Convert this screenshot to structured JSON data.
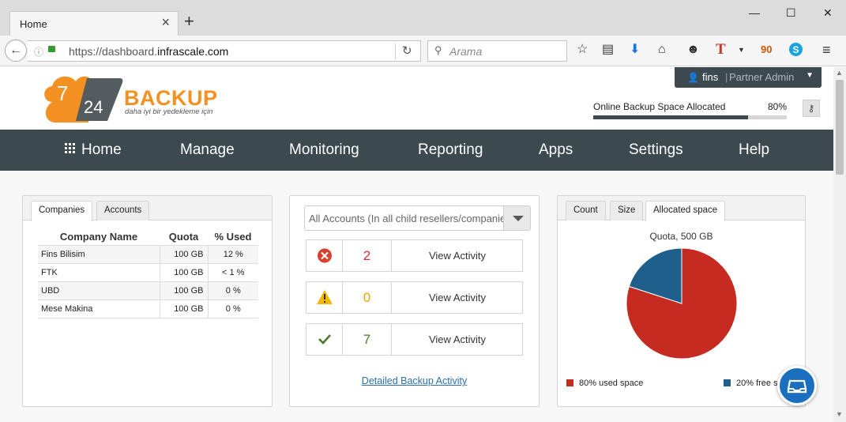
{
  "browser": {
    "tab_title": "Home",
    "url_prefix": "https://dashboard.",
    "url_domain": "infrascale.com",
    "search_placeholder": "Arama",
    "window_buttons": {
      "minimize": "—",
      "maximize": "☐",
      "close": "✕"
    }
  },
  "toolbar_icons": [
    "star-icon",
    "reader-icon",
    "download-icon",
    "home-icon",
    "emoji-icon",
    "t-extension-icon",
    "dropdown-icon",
    "90-extension-icon",
    "skype-icon",
    "menu-icon"
  ],
  "header": {
    "logo_number_7": "7",
    "logo_number_24": "24",
    "logo_word": "BACKUP",
    "logo_tagline": "daha iyi bir yedekleme için",
    "user_name": "fins",
    "user_separator": "|",
    "user_role": "Partner Admin",
    "allocated_label": "Online Backup Space Allocated",
    "allocated_pct": "80%",
    "allocated_fraction": 0.8
  },
  "nav": {
    "items": [
      {
        "label": "Home"
      },
      {
        "label": "Manage"
      },
      {
        "label": "Monitoring"
      },
      {
        "label": "Reporting"
      },
      {
        "label": "Apps"
      },
      {
        "label": "Settings"
      },
      {
        "label": "Help"
      }
    ]
  },
  "companies_panel": {
    "tabs": [
      "Companies",
      "Accounts"
    ],
    "columns": [
      "Company Name",
      "Quota",
      "% Used"
    ],
    "rows": [
      [
        "Fins Bilisim",
        "100 GB",
        "12 %"
      ],
      [
        "FTK",
        "100 GB",
        "< 1 %"
      ],
      [
        "UBD",
        "100 GB",
        "0 %"
      ],
      [
        "Mese Makina",
        "100 GB",
        "0 %"
      ]
    ]
  },
  "activity_panel": {
    "select_value": "All Accounts (In all child resellers/companies)",
    "rows": [
      {
        "icon": "error-icon",
        "count": "2",
        "count_color": "#cc3333",
        "action": "View Activity"
      },
      {
        "icon": "warning-icon",
        "count": "0",
        "count_color": "#e0a800",
        "action": "View Activity"
      },
      {
        "icon": "check-icon",
        "count": "7",
        "count_color": "#4a7a2a",
        "action": "View Activity"
      }
    ],
    "detail_link": "Detailed Backup Activity"
  },
  "space_panel": {
    "tabs": [
      "Count",
      "Size",
      "Allocated space"
    ],
    "pie_title": "Quota, 500 GB",
    "slices": [
      {
        "label": "80% used space",
        "value": 80,
        "color": "#c62b22"
      },
      {
        "label": "20% free s",
        "value": 20,
        "color": "#1f5f8b"
      }
    ]
  },
  "colors": {
    "nav_bg": "#3c4a4f",
    "accent_orange": "#f39223",
    "link_blue": "#2f6fa8"
  }
}
